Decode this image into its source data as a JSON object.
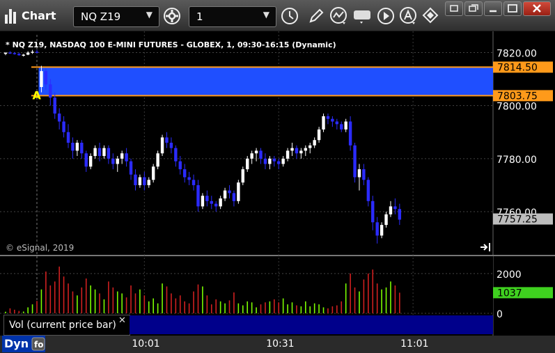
{
  "window": {
    "title": "Chart",
    "symbol": "NQ Z19",
    "interval": "1"
  },
  "header": {
    "description": "* NQ Z19, NASDAQ 100 E-MINI FUTURES - GLOBEX, 1, 09:30-16:15 (Dynamic)"
  },
  "watermark": "© eSignal, 2019",
  "study_label": "Vol (current price bar)",
  "bottom": {
    "mode": "Dyn"
  },
  "colors": {
    "up_bar": "#ffffff",
    "down_bar": "#2b2bff",
    "zone_fill": "#1f4fff",
    "zone_line": "#ff9a1a",
    "current_price_tag": "#bdbdbd",
    "volume_up": "#7cfc00",
    "volume_down": "#d02020",
    "volume_tag": "#3fd11f",
    "marker_a": "#ffff00"
  },
  "icons": [
    "chart-logo-icon",
    "settings-icon",
    "clock-icon",
    "pencil-icon",
    "indicator-icon",
    "get-icon",
    "play-icon",
    "a-circle-icon",
    "arrows-icon",
    "tile-icon",
    "restore-icon",
    "maximize-icon",
    "close-icon",
    "link-icon",
    "scroll-end-icon"
  ],
  "chart_data": [
    {
      "type": "candlestick",
      "title": "* NQ Z19, NASDAQ 100 E-MINI FUTURES - GLOBEX, 1, 09:30-16:15 (Dynamic)",
      "ylim": [
        7744,
        7828
      ],
      "y_ticks": [
        "7820.00",
        "7800.00",
        "7780.00",
        "7760.00"
      ],
      "y_tick_values": [
        7820,
        7800,
        7780,
        7760
      ],
      "x_ticks": [
        "10:01",
        "10:31",
        "11:01"
      ],
      "x_tick_index": [
        31,
        61,
        91
      ],
      "ohlc": [
        [
          7819.5,
          7820,
          7819,
          7820
        ],
        [
          7820,
          7820.5,
          7819.5,
          7819.8
        ],
        [
          7819.8,
          7820.2,
          7819.2,
          7819.5
        ],
        [
          7819.5,
          7820,
          7818.8,
          7819
        ],
        [
          7819,
          7819.5,
          7818.5,
          7819.2
        ],
        [
          7819.2,
          7820.5,
          7819,
          7820
        ],
        [
          7820,
          7821,
          7819.5,
          7820.3
        ],
        [
          7820.3,
          7821,
          7819.8,
          7819.9
        ],
        [
          7807,
          7815,
          7805,
          7813
        ],
        [
          7813,
          7814,
          7806,
          7808
        ],
        [
          7808,
          7810,
          7800,
          7803
        ],
        [
          7803,
          7805,
          7795,
          7797
        ],
        [
          7797,
          7799,
          7791,
          7794
        ],
        [
          7794,
          7796,
          7788,
          7790
        ],
        [
          7790,
          7793,
          7784,
          7786
        ],
        [
          7786,
          7788,
          7780,
          7783
        ],
        [
          7783,
          7787,
          7781,
          7786
        ],
        [
          7786,
          7787,
          7780,
          7782
        ],
        [
          7782,
          7783,
          7775,
          7777
        ],
        [
          7777,
          7782,
          7776,
          7781
        ],
        [
          7781,
          7785,
          7780,
          7784
        ],
        [
          7784,
          7786,
          7779,
          7781
        ],
        [
          7781,
          7785,
          7780,
          7784
        ],
        [
          7784,
          7785,
          7778,
          7780
        ],
        [
          7780,
          7782,
          7776,
          7778
        ],
        [
          7778,
          7781,
          7775,
          7780
        ],
        [
          7780,
          7783,
          7778,
          7782
        ],
        [
          7782,
          7784,
          7777,
          7779
        ],
        [
          7779,
          7780,
          7772,
          7774
        ],
        [
          7774,
          7776,
          7768,
          7770
        ],
        [
          7770,
          7774,
          7769,
          7773
        ],
        [
          7773,
          7775,
          7768,
          7770
        ],
        [
          7770,
          7773,
          7769,
          7772
        ],
        [
          7772,
          7778,
          7771,
          7777
        ],
        [
          7777,
          7783,
          7776,
          7782
        ],
        [
          7782,
          7789,
          7781,
          7788
        ],
        [
          7788,
          7790,
          7784,
          7786
        ],
        [
          7786,
          7788,
          7782,
          7784
        ],
        [
          7784,
          7785,
          7777,
          7779
        ],
        [
          7779,
          7781,
          7774,
          7776
        ],
        [
          7776,
          7778,
          7771,
          7773
        ],
        [
          7773,
          7775,
          7770,
          7772
        ],
        [
          7772,
          7774,
          7768,
          7770
        ],
        [
          7770,
          7772,
          7760,
          7762
        ],
        [
          7762,
          7767,
          7761,
          7766
        ],
        [
          7766,
          7768,
          7762,
          7764
        ],
        [
          7764,
          7766,
          7761,
          7763
        ],
        [
          7763,
          7764,
          7760,
          7762
        ],
        [
          7762,
          7766,
          7761,
          7765
        ],
        [
          7765,
          7769,
          7764,
          7768
        ],
        [
          7768,
          7770,
          7765,
          7767
        ],
        [
          7767,
          7768,
          7762,
          7764
        ],
        [
          7764,
          7772,
          7763,
          7771
        ],
        [
          7771,
          7777,
          7770,
          7776
        ],
        [
          7776,
          7781,
          7775,
          7780
        ],
        [
          7780,
          7783,
          7778,
          7782
        ],
        [
          7782,
          7784,
          7779,
          7783
        ],
        [
          7783,
          7784,
          7778,
          7780
        ],
        [
          7780,
          7782,
          7776,
          7778
        ],
        [
          7778,
          7781,
          7776,
          7780
        ],
        [
          7780,
          7781,
          7777,
          7779
        ],
        [
          7779,
          7780,
          7776,
          7778
        ],
        [
          7778,
          7781,
          7777,
          7780
        ],
        [
          7780,
          7784,
          7779,
          7783
        ],
        [
          7783,
          7786,
          7781,
          7784
        ],
        [
          7784,
          7785,
          7780,
          7782
        ],
        [
          7782,
          7784,
          7780,
          7783
        ],
        [
          7783,
          7785,
          7781,
          7784
        ],
        [
          7784,
          7786,
          7782,
          7785
        ],
        [
          7785,
          7788,
          7784,
          7787
        ],
        [
          7787,
          7792,
          7786,
          7791
        ],
        [
          7791,
          7797,
          7790,
          7796
        ],
        [
          7796,
          7797,
          7793,
          7795
        ],
        [
          7795,
          7796,
          7792,
          7794
        ],
        [
          7794,
          7795,
          7791,
          7793
        ],
        [
          7793,
          7794,
          7790,
          7791
        ],
        [
          7791,
          7795,
          7790,
          7794
        ],
        [
          7794,
          7796,
          7783,
          7785
        ],
        [
          7785,
          7786,
          7771,
          7773
        ],
        [
          7773,
          7778,
          7768,
          7776
        ],
        [
          7776,
          7778,
          7770,
          7772
        ],
        [
          7772,
          7773,
          7762,
          7764
        ],
        [
          7764,
          7766,
          7753,
          7756
        ],
        [
          7756,
          7758,
          7748,
          7751
        ],
        [
          7751,
          7756,
          7750,
          7755
        ],
        [
          7755,
          7760,
          7754,
          7759
        ],
        [
          7759,
          7764,
          7758,
          7762
        ],
        [
          7762,
          7765,
          7759,
          7761
        ],
        [
          7761,
          7763,
          7755,
          7757
        ]
      ],
      "zone": {
        "top": 7814.5,
        "bottom": 7803.75
      },
      "marker": {
        "label": "A",
        "index": 8
      },
      "price_tags": [
        {
          "label": "7814.50",
          "value": 7814.5,
          "kind": "zone"
        },
        {
          "label": "7803.75",
          "value": 7803.75,
          "kind": "zone"
        },
        {
          "label": "7757.25",
          "value": 7757.25,
          "kind": "last"
        }
      ]
    },
    {
      "type": "bar",
      "title": "Vol (current price bar)",
      "ylim": [
        0,
        2800
      ],
      "y_ticks": [
        "2000",
        "0"
      ],
      "y_tick_values": [
        2000,
        0
      ],
      "last_value": {
        "label": "1037",
        "value": 1037
      },
      "values": [
        80,
        250,
        180,
        120,
        90,
        300,
        450,
        620,
        1200,
        2100,
        1400,
        1600,
        2350,
        1850,
        1500,
        1100,
        900,
        1300,
        1750,
        1400,
        1200,
        1000,
        700,
        1600,
        1300,
        1100,
        1000,
        800,
        1400,
        1000,
        1200,
        900,
        600,
        750,
        500,
        1500,
        1350,
        1000,
        750,
        900,
        600,
        500,
        1100,
        1450,
        1350,
        900,
        450,
        700,
        600,
        500,
        650,
        1050,
        500,
        400,
        600,
        550,
        300,
        450,
        550,
        600,
        700,
        550,
        750,
        450,
        550,
        400,
        350,
        600,
        350,
        500,
        450,
        300,
        250,
        350,
        400,
        600,
        1500,
        2000,
        1300,
        1100,
        1700,
        2000,
        2200,
        1500,
        1200,
        1300,
        1600,
        1400,
        1037
      ]
    }
  ]
}
